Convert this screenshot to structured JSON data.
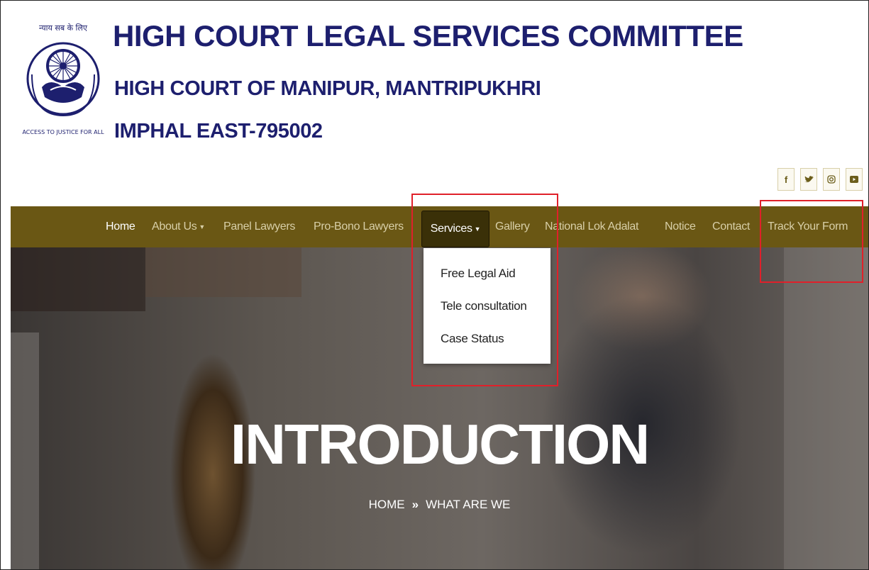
{
  "header": {
    "logo_text_top": "न्याय सब के लिए",
    "logo_text_ring": "ACCESS TO JUSTICE FOR ALL",
    "title": "HIGH COURT LEGAL SERVICES COMMITTEE",
    "subtitle": "HIGH COURT OF MANIPUR, MANTRIPUKHRI",
    "address": "IMPHAL EAST-795002"
  },
  "social": [
    {
      "icon": "facebook-icon",
      "glyph": "f"
    },
    {
      "icon": "twitter-icon",
      "glyph": "🐦"
    },
    {
      "icon": "instagram-icon",
      "glyph": "◎"
    },
    {
      "icon": "youtube-icon",
      "glyph": "▶"
    }
  ],
  "nav": {
    "items": [
      {
        "label": "Home"
      },
      {
        "label": "About Us"
      },
      {
        "label": "Panel Lawyers"
      },
      {
        "label": "Pro-Bono Lawyers"
      },
      {
        "label": "Services"
      },
      {
        "label": "Gallery"
      },
      {
        "label": "National Lok Adalat"
      },
      {
        "label": "Notice"
      },
      {
        "label": "Contact"
      },
      {
        "label": "Track Your Form"
      }
    ],
    "caret": "▼"
  },
  "services_dropdown": {
    "items": [
      {
        "label": "Free Legal Aid"
      },
      {
        "label": "Tele consultation"
      },
      {
        "label": "Case Status"
      }
    ]
  },
  "hero": {
    "title": "INTRODUCTION",
    "breadcrumb_home": "HOME",
    "breadcrumb_sep": "»",
    "breadcrumb_current": "WHAT ARE WE"
  },
  "colors": {
    "title_blue": "#1d1f6e",
    "nav_bg": "#6a5714",
    "nav_active_bg": "#3a3008",
    "highlight_red": "#e0202a"
  }
}
